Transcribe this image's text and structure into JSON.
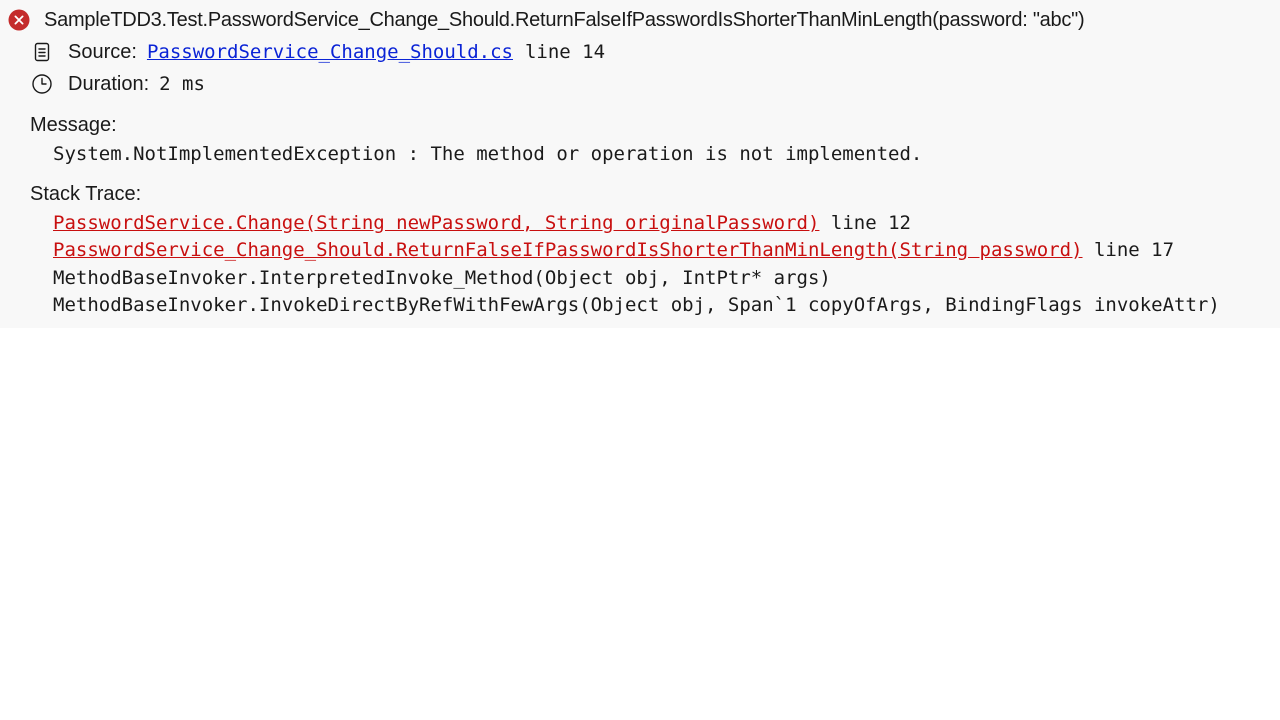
{
  "test": {
    "status_icon": "error-circle-icon",
    "name": "SampleTDD3.Test.PasswordService_Change_Should.ReturnFalseIfPasswordIsShorterThanMinLength(password: \"abc\")"
  },
  "source": {
    "icon": "document-icon",
    "label": "Source:",
    "file": "PasswordService_Change_Should.cs",
    "line_text": "line 14"
  },
  "duration": {
    "icon": "clock-icon",
    "label": "Duration:",
    "value": "2 ms"
  },
  "message": {
    "label": "Message:",
    "text": "System.NotImplementedException : The method or operation is not implemented."
  },
  "stack_trace": {
    "label": "Stack Trace:",
    "frames": [
      {
        "method": "PasswordService.Change(String newPassword, String originalPassword)",
        "line_text": "line 12"
      },
      {
        "method": "PasswordService_Change_Should.ReturnFalseIfPasswordIsShorterThanMinLength(String password)",
        "line_text": "line 17"
      },
      {
        "text": "MethodBaseInvoker.InterpretedInvoke_Method(Object obj, IntPtr* args)"
      },
      {
        "text": "MethodBaseInvoker.InvokeDirectByRefWithFewArgs(Object obj, Span`1 copyOfArgs, BindingFlags invokeAttr)"
      }
    ]
  },
  "colors": {
    "panel_background": "#f8f8f8",
    "error_icon": "#c42b2b",
    "source_link": "#0a23d6",
    "trace_link": "#c80f0f"
  }
}
